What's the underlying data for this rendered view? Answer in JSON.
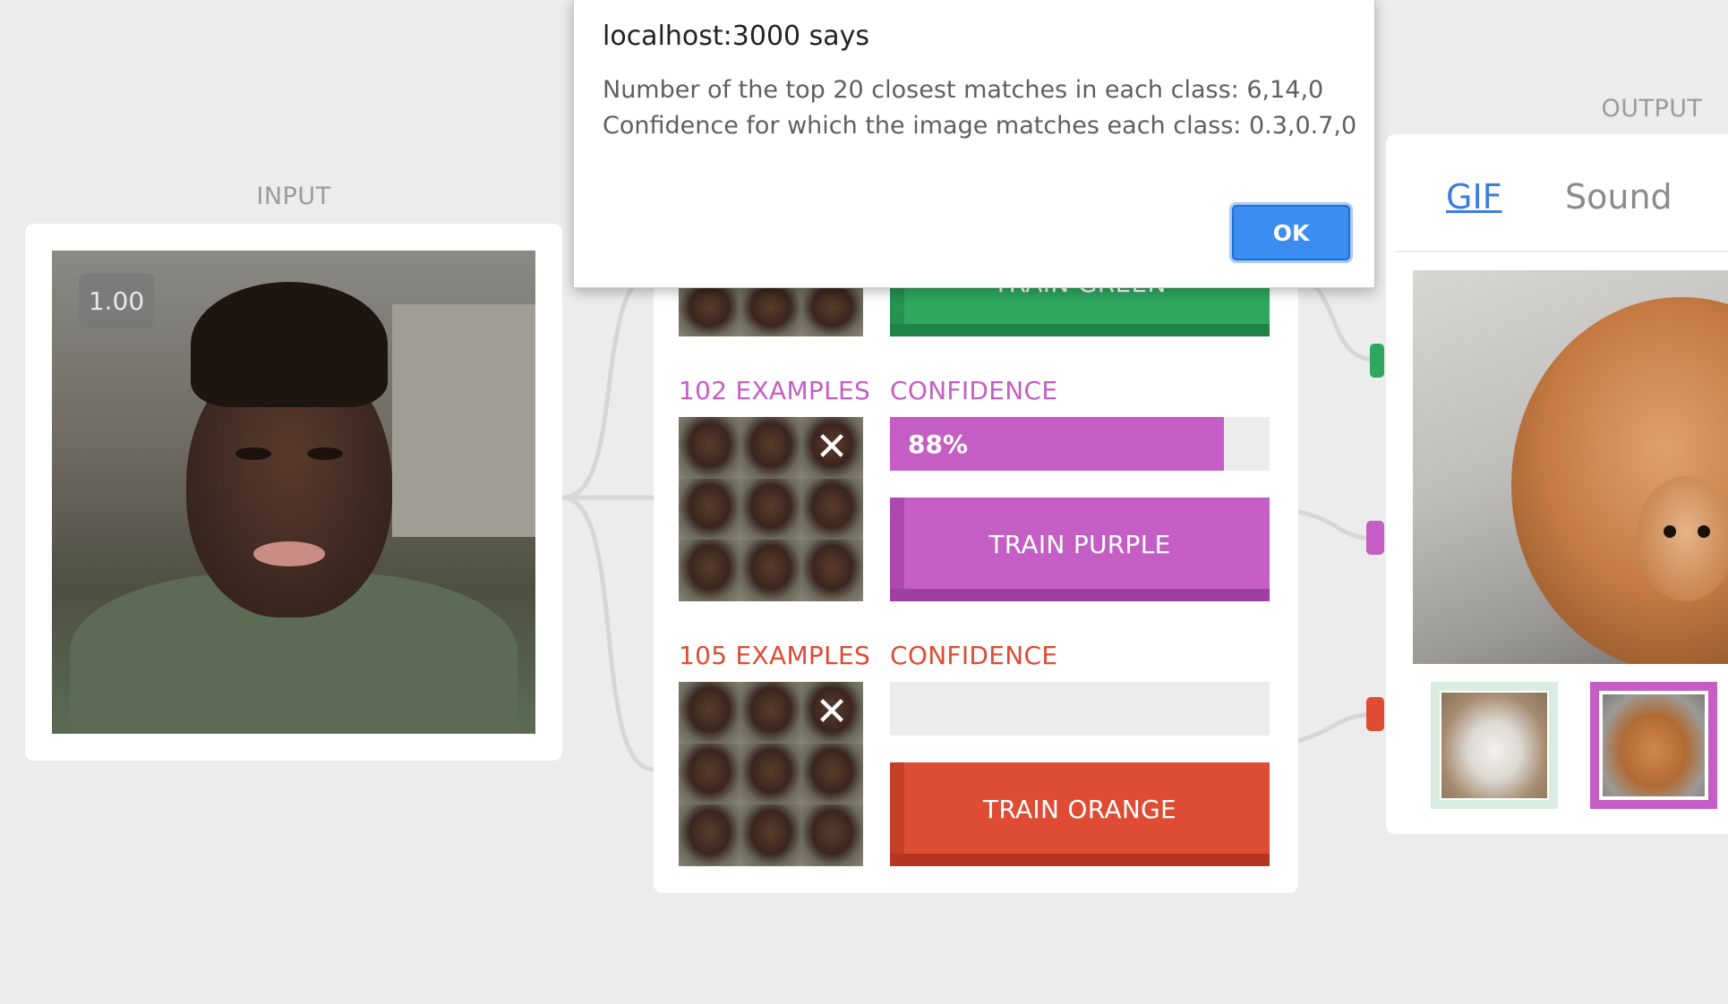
{
  "input": {
    "title": "INPUT",
    "confidence_badge": "1.00"
  },
  "output": {
    "title": "OUTPUT",
    "tabs": [
      {
        "label": "GIF",
        "active": true
      },
      {
        "label": "Sound",
        "active": false
      }
    ],
    "thumbnails": [
      {
        "subject": "cat",
        "border_color": "#d9ecdf",
        "selected": false
      },
      {
        "subject": "dog",
        "border_color": "#c45ec4",
        "selected": true
      }
    ]
  },
  "classes": [
    {
      "name": "green",
      "train_label": "TRAIN GREEN",
      "color": "#2ea85f",
      "dark": "#1f8246"
    },
    {
      "name": "purple",
      "examples_label": "102 EXAMPLES",
      "confidence_label": "CONFIDENCE",
      "confidence_percent": 88,
      "confidence_text": "88%",
      "train_label": "TRAIN PURPLE",
      "color": "#c45ec4",
      "dark": "#9f3f9f"
    },
    {
      "name": "orange",
      "examples_label": "105 EXAMPLES",
      "confidence_label": "CONFIDENCE",
      "confidence_percent": 0,
      "confidence_text": "",
      "train_label": "TRAIN ORANGE",
      "color": "#dd4c33",
      "dark": "#b33522"
    }
  ],
  "dialog": {
    "title": "localhost:3000 says",
    "line1": "Number of the top 20 closest matches in each class: 6,14,0",
    "line2": "Confidence for which the image matches each class: 0.3,0.7,0",
    "ok_label": "OK"
  }
}
